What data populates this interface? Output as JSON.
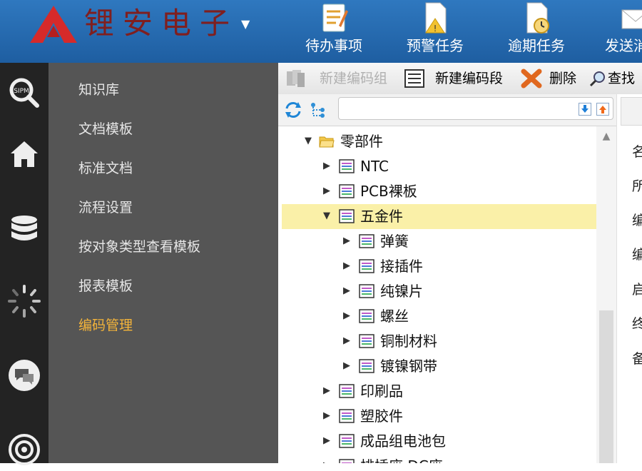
{
  "brand": {
    "name": "锂安电子",
    "logo_color": "#d62a2a",
    "text_color": "#7f1f1f"
  },
  "header": {
    "bg": "#2a70b8",
    "nav": [
      {
        "label": "待办事项",
        "icon": "todo-icon"
      },
      {
        "label": "预警任务",
        "icon": "warning-task-icon"
      },
      {
        "label": "逾期任务",
        "icon": "overdue-task-icon"
      },
      {
        "label": "发送消",
        "icon": "send-mail-icon"
      }
    ]
  },
  "iconbar": {
    "items": [
      {
        "icon": "sipm-search-icon"
      },
      {
        "icon": "home-icon"
      },
      {
        "icon": "database-icon"
      },
      {
        "icon": "loading-spinner-icon"
      },
      {
        "icon": "chat-icon"
      },
      {
        "icon": "broadcast-icon"
      }
    ]
  },
  "menu": {
    "items": [
      {
        "label": "知识库"
      },
      {
        "label": "文档模板"
      },
      {
        "label": "标准文档"
      },
      {
        "label": "流程设置"
      },
      {
        "label": "按对象类型查看模板"
      },
      {
        "label": "报表模板"
      },
      {
        "label": "编码管理",
        "active": true
      }
    ],
    "active_color": "#f4b43a"
  },
  "toolbar": {
    "new_code_group": "新建编码组",
    "new_code_segment": "新建编码段",
    "delete": "删除",
    "find": "查找"
  },
  "search": {
    "value": "",
    "placeholder": ""
  },
  "tree": {
    "rows": [
      {
        "label": "零部件",
        "level": 0,
        "expanded": true,
        "type": "folder"
      },
      {
        "label": "NTC",
        "level": 1,
        "expanded": false,
        "type": "node"
      },
      {
        "label": "PCB裸板",
        "level": 1,
        "expanded": false,
        "type": "node"
      },
      {
        "label": "五金件",
        "level": 1,
        "expanded": true,
        "type": "node",
        "selected": true
      },
      {
        "label": "弹簧",
        "level": 2,
        "expanded": false,
        "type": "node"
      },
      {
        "label": "接插件",
        "level": 2,
        "expanded": false,
        "type": "node"
      },
      {
        "label": "纯镍片",
        "level": 2,
        "expanded": false,
        "type": "node"
      },
      {
        "label": "螺丝",
        "level": 2,
        "expanded": false,
        "type": "node"
      },
      {
        "label": "铜制材料",
        "level": 2,
        "expanded": false,
        "type": "node"
      },
      {
        "label": "镀镍钢带",
        "level": 2,
        "expanded": false,
        "type": "node"
      },
      {
        "label": "印刷品",
        "level": 1,
        "expanded": false,
        "type": "node"
      },
      {
        "label": "塑胶件",
        "level": 1,
        "expanded": false,
        "type": "node"
      },
      {
        "label": "成品组电池包",
        "level": 1,
        "expanded": false,
        "type": "node"
      },
      {
        "label": "排插座 DC座",
        "level": 1,
        "expanded": false,
        "type": "node"
      }
    ],
    "selected_color": "#faf0a8"
  },
  "right_pane": {
    "labels": [
      "名",
      "所",
      "编",
      "编",
      "启",
      "终",
      "备"
    ]
  }
}
